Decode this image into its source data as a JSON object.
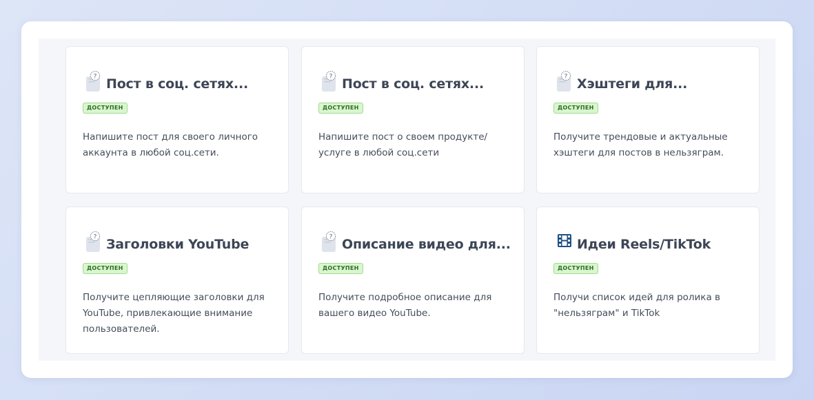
{
  "cards": [
    {
      "title": "Пост в соц. сетях...",
      "badge": "ДОСТУПЕН",
      "description": "Напишите пост для своего личного аккаунта в любой соц.сети.",
      "icon": "question-note-icon"
    },
    {
      "title": "Пост в соц. сетях...",
      "badge": "ДОСТУПЕН",
      "description": "Напишите пост о своем продукте/ услуге в любой соц.сети",
      "icon": "question-note-icon"
    },
    {
      "title": "Хэштеги для...",
      "badge": "ДОСТУПЕН",
      "description": "Получите трендовые и актуальные хэштеги для постов в нельзяграм.",
      "icon": "question-note-icon"
    },
    {
      "title": "Заголовки YouTube",
      "badge": "ДОСТУПЕН",
      "description": "Получите цепляющие заголовки для YouTube, привлекающие внимание пользователей.",
      "icon": "question-note-icon"
    },
    {
      "title": "Описание видео для...",
      "badge": "ДОСТУПЕН",
      "description": "Получите подробное описание для вашего видео YouTube.",
      "icon": "question-note-icon"
    },
    {
      "title": "Идеи Reels/TikTok",
      "badge": "ДОСТУПЕН",
      "description": "Получи список идей для ролика в \"нельзяграм\" и TikTok",
      "icon": "film-frames-icon"
    }
  ],
  "colors": {
    "badge_bg": "#d9f6cf",
    "badge_border": "#9fdc8e",
    "badge_text": "#2d6b25",
    "title": "#3d4656",
    "film_icon": "#1f4f86"
  }
}
